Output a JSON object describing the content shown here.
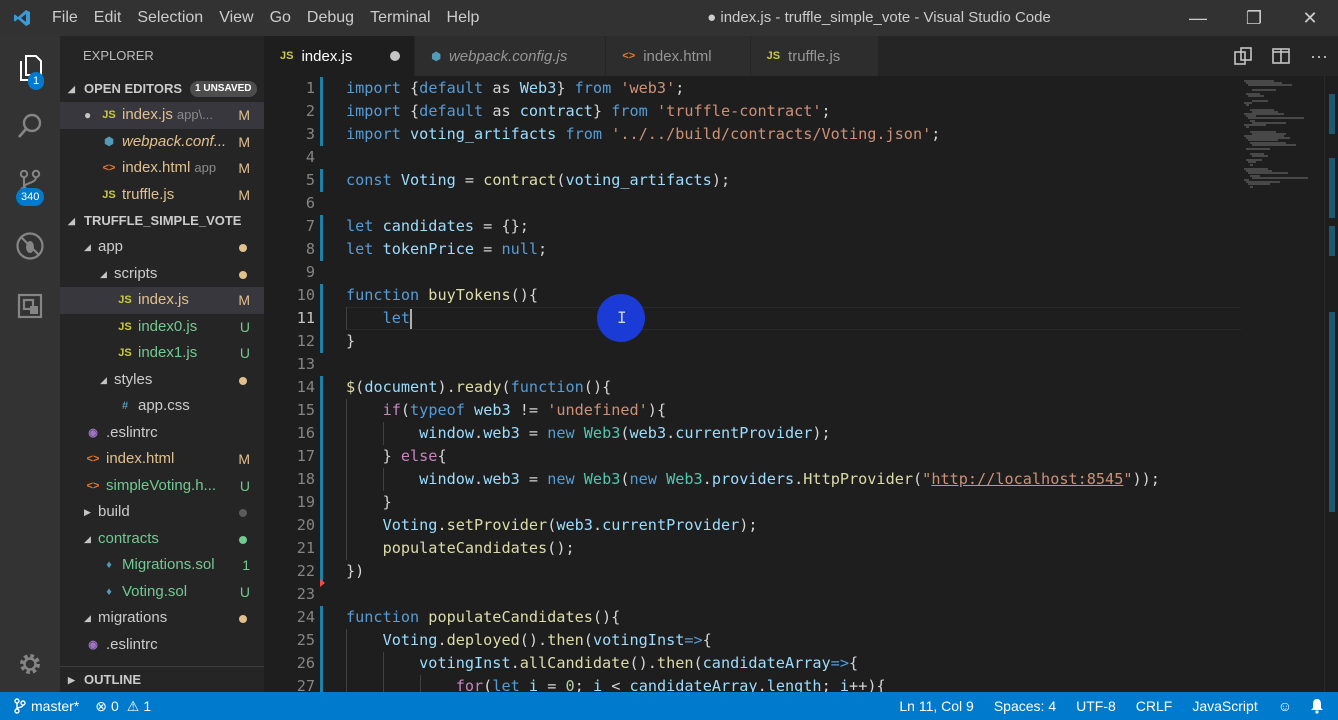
{
  "titlebar": {
    "menu": [
      "File",
      "Edit",
      "Selection",
      "View",
      "Go",
      "Debug",
      "Terminal",
      "Help"
    ],
    "title": "● index.js - truffle_simple_vote - Visual Studio Code",
    "minimize": "—",
    "restore": "❐",
    "close": "✕"
  },
  "activity": {
    "explorer_badge": "1",
    "scm_badge": "340"
  },
  "sidebar": {
    "title": "EXPLORER",
    "open_editors": {
      "header": "OPEN EDITORS",
      "badge": "1 UNSAVED",
      "items": [
        {
          "icon": "JS",
          "label": "index.js",
          "desc": "app\\...",
          "status": "M",
          "dirty": "●"
        },
        {
          "icon": "⬢",
          "label": "webpack.conf...",
          "desc": "",
          "status": "M"
        },
        {
          "icon": "<>",
          "label": "index.html",
          "desc": "app",
          "status": "M"
        },
        {
          "icon": "JS",
          "label": "truffle.js",
          "desc": "",
          "status": "M"
        }
      ]
    },
    "project": {
      "header": "TRUFFLE_SIMPLE_VOTE",
      "items": [
        {
          "label": "app",
          "icon": "",
          "status": ""
        },
        {
          "label": "scripts",
          "icon": "",
          "status": ""
        },
        {
          "label": "index.js",
          "icon": "JS",
          "status": "M"
        },
        {
          "label": "index0.js",
          "icon": "JS",
          "status": "U"
        },
        {
          "label": "index1.js",
          "icon": "JS",
          "status": "U"
        },
        {
          "label": "styles",
          "icon": "",
          "status": ""
        },
        {
          "label": "app.css",
          "icon": "#",
          "status": ""
        },
        {
          "label": ".eslintrc",
          "icon": "◉",
          "status": ""
        },
        {
          "label": "index.html",
          "icon": "<>",
          "status": "M"
        },
        {
          "label": "simpleVoting.h...",
          "icon": "<>",
          "status": "U"
        },
        {
          "label": "build",
          "icon": "",
          "status": ""
        },
        {
          "label": "contracts",
          "icon": "",
          "status": ""
        },
        {
          "label": "Migrations.sol",
          "icon": "♦",
          "status": "1"
        },
        {
          "label": "Voting.sol",
          "icon": "♦",
          "status": "U"
        },
        {
          "label": "migrations",
          "icon": "",
          "status": ""
        },
        {
          "label": ".eslintrc",
          "icon": "◉",
          "status": ""
        }
      ]
    },
    "outline": "OUTLINE"
  },
  "tabs": [
    {
      "icon": "JS",
      "label": "index.js",
      "active": true,
      "dirty": true
    },
    {
      "icon": "⬢",
      "label": "webpack.config.js",
      "active": false
    },
    {
      "icon": "<>",
      "label": "index.html",
      "active": false
    },
    {
      "icon": "JS",
      "label": "truffle.js",
      "active": false
    }
  ],
  "editor": {
    "active_line": 11,
    "lines": [
      [
        [
          "kw",
          "import "
        ],
        [
          "p",
          "{"
        ],
        [
          "kw",
          "default"
        ],
        [
          "p",
          " as "
        ],
        [
          "var",
          "Web3"
        ],
        [
          "p",
          "} "
        ],
        [
          "kw",
          "from "
        ],
        [
          "str",
          "'web3'"
        ],
        [
          "p",
          ";"
        ]
      ],
      [
        [
          "kw",
          "import "
        ],
        [
          "p",
          "{"
        ],
        [
          "kw",
          "default"
        ],
        [
          "p",
          " as "
        ],
        [
          "var",
          "contract"
        ],
        [
          "p",
          "} "
        ],
        [
          "kw",
          "from "
        ],
        [
          "str",
          "'truffle-contract'"
        ],
        [
          "p",
          ";"
        ]
      ],
      [
        [
          "kw",
          "import "
        ],
        [
          "var",
          "voting_artifacts"
        ],
        [
          "kw",
          " from "
        ],
        [
          "str",
          "'../../build/contracts/Voting.json'"
        ],
        [
          "p",
          ";"
        ]
      ],
      [],
      [
        [
          "kw",
          "const "
        ],
        [
          "var",
          "Voting"
        ],
        [
          "p",
          " = "
        ],
        [
          "fn",
          "contract"
        ],
        [
          "p",
          "("
        ],
        [
          "var",
          "voting_artifacts"
        ],
        [
          "p",
          ");"
        ]
      ],
      [],
      [
        [
          "kw",
          "let "
        ],
        [
          "var",
          "candidates"
        ],
        [
          "p",
          " = {};"
        ]
      ],
      [
        [
          "kw",
          "let "
        ],
        [
          "var",
          "tokenPrice"
        ],
        [
          "p",
          " = "
        ],
        [
          "kw",
          "null"
        ],
        [
          "p",
          ";"
        ]
      ],
      [],
      [
        [
          "kw",
          "function "
        ],
        [
          "fn",
          "buyTokens"
        ],
        [
          "p",
          "(){"
        ]
      ],
      [
        [
          "p",
          "    "
        ],
        [
          "kw",
          "let"
        ]
      ],
      [
        [
          "p",
          "}"
        ]
      ],
      [],
      [
        [
          "fn",
          "$"
        ],
        [
          "p",
          "("
        ],
        [
          "var",
          "document"
        ],
        [
          "p",
          ")."
        ],
        [
          "fn",
          "ready"
        ],
        [
          "p",
          "("
        ],
        [
          "kw",
          "function"
        ],
        [
          "p",
          "(){"
        ]
      ],
      [
        [
          "p",
          "    "
        ],
        [
          "ctl",
          "if"
        ],
        [
          "p",
          "("
        ],
        [
          "kw",
          "typeof "
        ],
        [
          "var",
          "web3"
        ],
        [
          "p",
          " != "
        ],
        [
          "str",
          "'undefined'"
        ],
        [
          "p",
          "){"
        ]
      ],
      [
        [
          "p",
          "        "
        ],
        [
          "var",
          "window"
        ],
        [
          "p",
          "."
        ],
        [
          "var",
          "web3"
        ],
        [
          "p",
          " = "
        ],
        [
          "kw",
          "new "
        ],
        [
          "ty",
          "Web3"
        ],
        [
          "p",
          "("
        ],
        [
          "var",
          "web3"
        ],
        [
          "p",
          "."
        ],
        [
          "var",
          "currentProvider"
        ],
        [
          "p",
          ");"
        ]
      ],
      [
        [
          "p",
          "    } "
        ],
        [
          "ctl",
          "else"
        ],
        [
          "p",
          "{"
        ]
      ],
      [
        [
          "p",
          "        "
        ],
        [
          "var",
          "window"
        ],
        [
          "p",
          "."
        ],
        [
          "var",
          "web3"
        ],
        [
          "p",
          " = "
        ],
        [
          "kw",
          "new "
        ],
        [
          "ty",
          "Web3"
        ],
        [
          "p",
          "("
        ],
        [
          "kw",
          "new "
        ],
        [
          "ty",
          "Web3"
        ],
        [
          "p",
          "."
        ],
        [
          "var",
          "providers"
        ],
        [
          "p",
          "."
        ],
        [
          "fn",
          "HttpProvider"
        ],
        [
          "p",
          "("
        ],
        [
          "str",
          "\""
        ],
        [
          "lnk",
          "http://localhost:8545"
        ],
        [
          "str",
          "\""
        ],
        [
          "p",
          "));"
        ]
      ],
      [
        [
          "p",
          "    }"
        ]
      ],
      [
        [
          "p",
          "    "
        ],
        [
          "var",
          "Voting"
        ],
        [
          "p",
          "."
        ],
        [
          "fn",
          "setProvider"
        ],
        [
          "p",
          "("
        ],
        [
          "var",
          "web3"
        ],
        [
          "p",
          "."
        ],
        [
          "var",
          "currentProvider"
        ],
        [
          "p",
          ");"
        ]
      ],
      [
        [
          "p",
          "    "
        ],
        [
          "fn",
          "populateCandidates"
        ],
        [
          "p",
          "();"
        ]
      ],
      [
        [
          "p",
          "})"
        ]
      ],
      [],
      [
        [
          "kw",
          "function "
        ],
        [
          "fn",
          "populateCandidates"
        ],
        [
          "p",
          "(){"
        ]
      ],
      [
        [
          "p",
          "    "
        ],
        [
          "var",
          "Voting"
        ],
        [
          "p",
          "."
        ],
        [
          "fn",
          "deployed"
        ],
        [
          "p",
          "()."
        ],
        [
          "fn",
          "then"
        ],
        [
          "p",
          "("
        ],
        [
          "var",
          "votingInst"
        ],
        [
          "kw",
          "=>"
        ],
        [
          "p",
          "{"
        ]
      ],
      [
        [
          "p",
          "        "
        ],
        [
          "var",
          "votingInst"
        ],
        [
          "p",
          "."
        ],
        [
          "fn",
          "allCandidate"
        ],
        [
          "p",
          "()."
        ],
        [
          "fn",
          "then"
        ],
        [
          "p",
          "("
        ],
        [
          "var",
          "candidateArray"
        ],
        [
          "kw",
          "=>"
        ],
        [
          "p",
          "{"
        ]
      ],
      [
        [
          "p",
          "            "
        ],
        [
          "ctl",
          "for"
        ],
        [
          "p",
          "("
        ],
        [
          "kw",
          "let "
        ],
        [
          "var",
          "i"
        ],
        [
          "p",
          " = "
        ],
        [
          "num",
          "0"
        ],
        [
          "p",
          "; "
        ],
        [
          "var",
          "i"
        ],
        [
          "p",
          " < "
        ],
        [
          "var",
          "candidateArray"
        ],
        [
          "p",
          "."
        ],
        [
          "var",
          "length"
        ],
        [
          "p",
          "; "
        ],
        [
          "var",
          "i"
        ],
        [
          "p",
          "++){"
        ]
      ]
    ]
  },
  "statusbar": {
    "branch": "master*",
    "errors": "0",
    "warnings": "1",
    "position": "Ln 11, Col 9",
    "spaces": "Spaces: 4",
    "encoding": "UTF-8",
    "eol": "CRLF",
    "language": "JavaScript"
  }
}
